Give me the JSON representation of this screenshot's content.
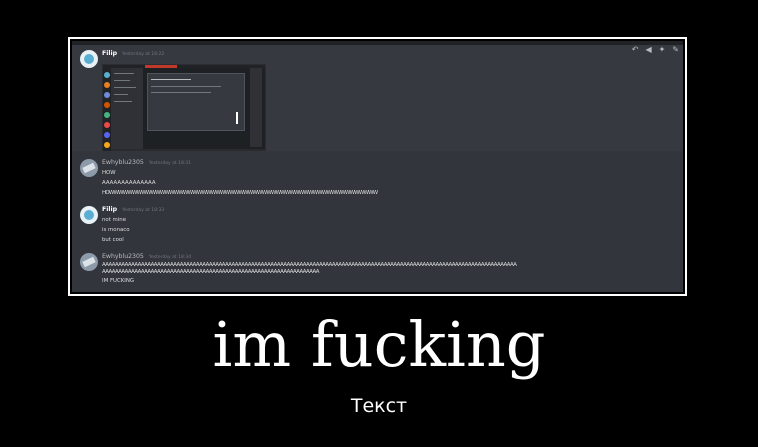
{
  "caption": "im fucking",
  "subtitle": "Текст",
  "toolbar": {
    "reply_icon": "reply-icon",
    "share_icon": "share-icon",
    "pin_icon": "pin-icon",
    "edit_icon": "edit-icon"
  },
  "messages": [
    {
      "author": "Filip",
      "timestamp": "Yesterday at 18:22",
      "lines": [],
      "attachment": "screenshot"
    },
    {
      "author": "Ewhyblu2305",
      "timestamp": "Yesterday at 18:31",
      "lines": [
        "HOW",
        "AAAAAAAAAAAAAA",
        "HOWWWWWWWWWWWWWWWWWWWWWWWWWWWWWWWWWWWWWWWWWWWWWWWWWWWWWWWWWW"
      ]
    },
    {
      "author": "Filip",
      "timestamp": "Yesterday at 18:33",
      "lines": [
        "not mine",
        "is monaco",
        "but cool"
      ]
    },
    {
      "author": "Ewhyblu2305",
      "timestamp": "Yesterday at 18:34",
      "lines": [
        "AAAAAAAAAAAAAAAAAAAAAAAAAAAAAAAAAAAAAAAAAAAAAAAAAAAAAAAAAAAAAAAAAAAAAAAAAAAAAAAAAAAAAAAAAAAAAAAAAAAAAAAAAAAAAAAAAAAAAAAAAAAAAAAA",
        "AAAAAAAAAAAAAAAAAAAAAAAAAAAAAAAAAAAAAAAAAAAAAAAAAAAAAAAAAAAAAAAAAAA",
        "IM FUCKING"
      ]
    }
  ],
  "colors": {
    "background": "#000000",
    "discord_bg": "#36393f",
    "text": "#dcddde",
    "timestamp": "#72767d"
  }
}
